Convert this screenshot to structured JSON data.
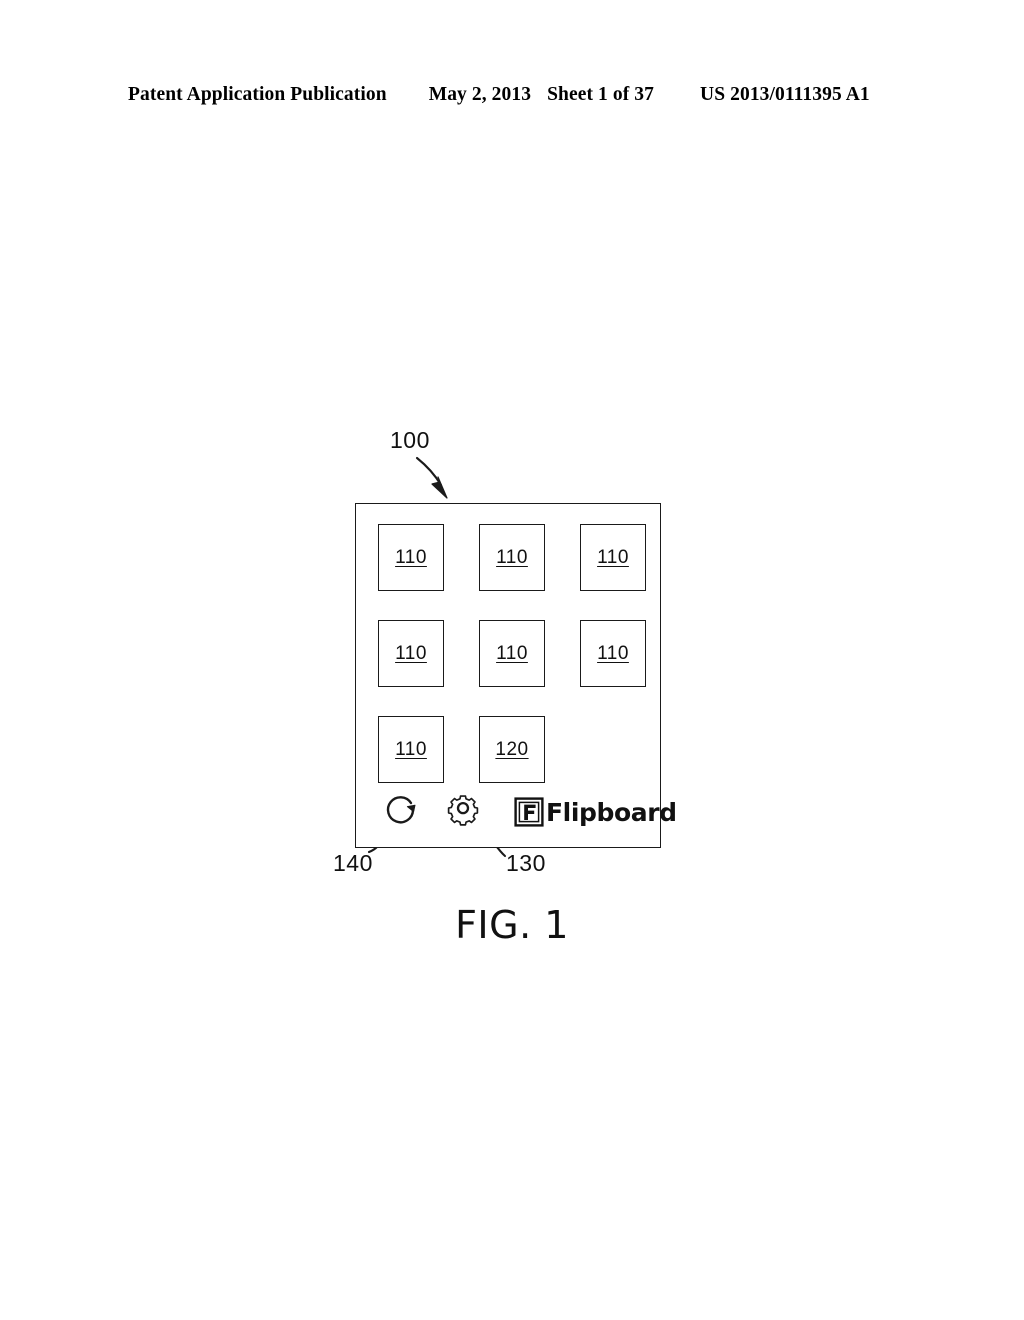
{
  "header": {
    "publication": "Patent Application Publication",
    "date": "May 2, 2013",
    "sheet": "Sheet 1 of 37",
    "number": "US 2013/0111395 A1"
  },
  "figure": {
    "caption": "FIG. 1",
    "device_label": "100",
    "tiles": [
      {
        "label": "110"
      },
      {
        "label": "110"
      },
      {
        "label": "110"
      },
      {
        "label": "110"
      },
      {
        "label": "110"
      },
      {
        "label": "110"
      },
      {
        "label": "110"
      },
      {
        "label": "120"
      }
    ],
    "toolbar": {
      "refresh_icon": "refresh-circular-arrow-icon",
      "gear_icon": "gear-settings-icon",
      "brand_mark_letter": "F",
      "brand_name": "Flipboard"
    },
    "callouts": [
      {
        "id": "device",
        "label": "100"
      },
      {
        "id": "refresh",
        "label": "140"
      },
      {
        "id": "settings",
        "label": "130"
      }
    ]
  },
  "colors": {
    "ink": "#111111",
    "outline": "#1a1a1a",
    "paper": "#ffffff"
  }
}
